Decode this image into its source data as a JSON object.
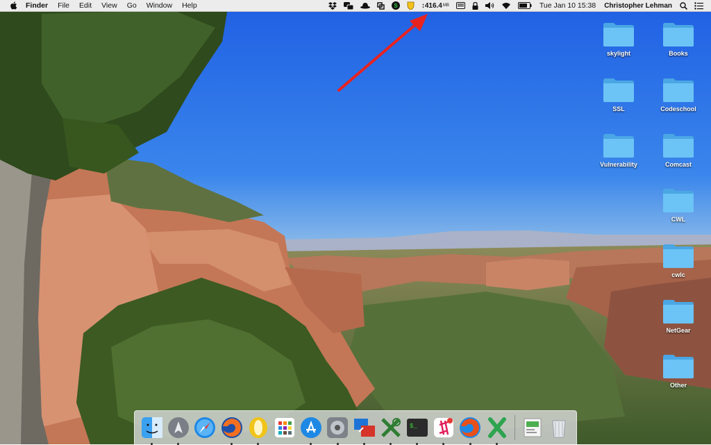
{
  "menubar": {
    "app_name": "Finder",
    "menus": [
      "File",
      "Edit",
      "View",
      "Go",
      "Window",
      "Help"
    ],
    "status_icons": [
      "dropbox-icon",
      "chat-icon",
      "alfred-hat-icon",
      "crop-icon",
      "skype-icon",
      "shield-icon"
    ],
    "memory_value": "416.4",
    "memory_unit": "MB",
    "tray_icons": [
      "keyboard-icon",
      "lock-icon",
      "volume-icon",
      "wifi-icon",
      "battery-icon"
    ],
    "clock": "Tue Jan 10  15:38",
    "user": "Christopher Lehman"
  },
  "desktop": {
    "folders": [
      {
        "label": "skylight"
      },
      {
        "label": "Books"
      },
      {
        "label": "SSL"
      },
      {
        "label": "Codeschool"
      },
      {
        "label": "Vulnerability"
      },
      {
        "label": "Comcast"
      },
      {
        "label": "CWL"
      },
      {
        "label": "cwlc"
      },
      {
        "label": "NetGear"
      },
      {
        "label": "Other"
      }
    ]
  },
  "dock": {
    "apps": [
      "finder-icon",
      "launchpad-icon",
      "safari-icon",
      "firefox-icon",
      "opera-icon",
      "app-grid-icon",
      "app-store-icon",
      "system-preferences-icon",
      "screen-sharing-icon",
      "x-utility-icon",
      "terminal-icon",
      "slack-icon",
      "firefox-developer-icon",
      "excel-icon",
      "preview-icon",
      "trash-icon"
    ],
    "running": [
      "finder-icon",
      "launchpad-icon",
      "firefox-icon",
      "opera-icon",
      "app-store-icon",
      "system-preferences-icon",
      "screen-sharing-icon",
      "x-utility-icon",
      "terminal-icon",
      "slack-icon",
      "firefox-developer-icon",
      "excel-icon"
    ]
  },
  "colors": {
    "sky": "#2d6fe6",
    "folder": "#5bb9f2",
    "annotation_arrow": "#e8231f",
    "rock": "#c8785a"
  }
}
